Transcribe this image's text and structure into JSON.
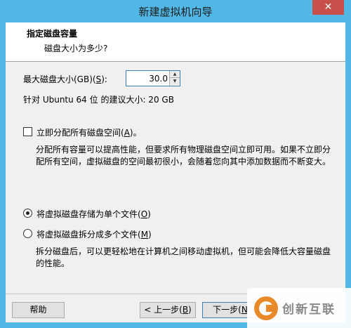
{
  "window": {
    "title": "新建虚拟机向导",
    "close_glyph": "✕"
  },
  "header": {
    "title": "指定磁盘容量",
    "subtitle": "磁盘大小为多少?"
  },
  "disk_size": {
    "label_pre": "最大磁盘大小(GB)(",
    "label_key": "S",
    "label_post": "):",
    "value": "30.0",
    "recommended": "针对 Ubuntu 64 位 的建议大小: 20 GB"
  },
  "allocate": {
    "checked": false,
    "label_pre": "立即分配所有磁盘空间(",
    "label_key": "A",
    "label_post": ")。",
    "description": "分配所有容量可以提高性能，但要求所有物理磁盘空间立即可用。如果不立即分配所有空间，虚拟磁盘的空间最初很小，会随着您向其中添加数据而不断变大。"
  },
  "storage_options": [
    {
      "label_pre": "将虚拟磁盘存储为单个文件(",
      "label_key": "O",
      "label_post": ")",
      "selected": true
    },
    {
      "label_pre": "将虚拟磁盘拆分成多个文件(",
      "label_key": "M",
      "label_post": ")",
      "selected": false
    }
  ],
  "split_description": "拆分磁盘后，可以更轻松地在计算机之间移动虚拟机，但可能会降低大容量磁盘的性能。",
  "buttons": {
    "help": "帮助",
    "back_pre": "< 上一步(",
    "back_key": "B",
    "back_post": ")",
    "next_pre": "下一步(",
    "next_key": "N"
  },
  "watermark": {
    "text": "创新互联"
  },
  "colors": {
    "titlebar": "#51b8e6",
    "close_button": "#c7504b",
    "dialog_bg": "#f0f0f0",
    "accent_border": "#3c7fb1",
    "watermark_logo": "#e88a2a"
  }
}
